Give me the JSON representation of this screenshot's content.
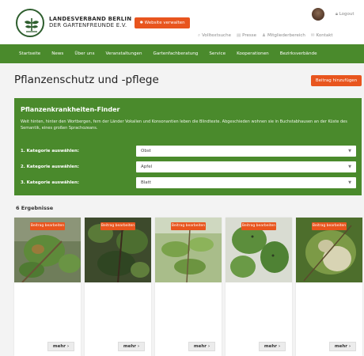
{
  "header": {
    "org_line1": "LANDESVERBAND BERLIN",
    "org_line2": "DER GARTENFREUNDE E.V.",
    "manage_button": "✱ Website verwalten",
    "logout": "Logout",
    "links": [
      {
        "icon": "search-icon",
        "label": "Volltextsuche"
      },
      {
        "icon": "press-icon",
        "label": "Presse"
      },
      {
        "icon": "user-icon",
        "label": "Mitgliederbereich"
      },
      {
        "icon": "contact-icon",
        "label": "Kontakt"
      }
    ]
  },
  "nav": [
    "Startseite",
    "News",
    "Über uns",
    "Veranstaltungen",
    "Gartenfachberatung",
    "Service",
    "Kooperationen",
    "Bezirksverbände"
  ],
  "page": {
    "title": "Pflanzenschutz und -pflege",
    "add_button": "Beitrag hinzufügen"
  },
  "finder": {
    "title": "Pflanzenkrankheiten-Finder",
    "description": "Weit hinten, hinter den Wortbergen, fern der Länder Vokalien und Konsonantien leben die Blindtexte. Abgeschieden wohnen sie in Buchstabhausen an der Küste des Semantik, eines großen Sprachozeans.",
    "rows": [
      {
        "label": "1. Kategorie auswählen:",
        "value": "Obst"
      },
      {
        "label": "2. Kategorie auswählen:",
        "value": "Apfel"
      },
      {
        "label": "3. Kategorie auswählen:",
        "value": "Blatt"
      }
    ]
  },
  "results": {
    "count_label": "6 Ergebnisse",
    "cards": [
      {
        "edit": "Beitrag bearbeiten",
        "more": "mehr  ›"
      },
      {
        "edit": "Beitrag bearbeiten",
        "more": "mehr  ›"
      },
      {
        "edit": "Beitrag bearbeiten",
        "more": "mehr  ›"
      },
      {
        "edit": "Beitrag bearbeiten",
        "more": "mehr  ›"
      },
      {
        "edit": "Beitrag bearbeiten",
        "more": "mehr  ›"
      }
    ]
  },
  "colors": {
    "brand_green": "#4a8a2c",
    "accent_orange": "#e8551e"
  }
}
